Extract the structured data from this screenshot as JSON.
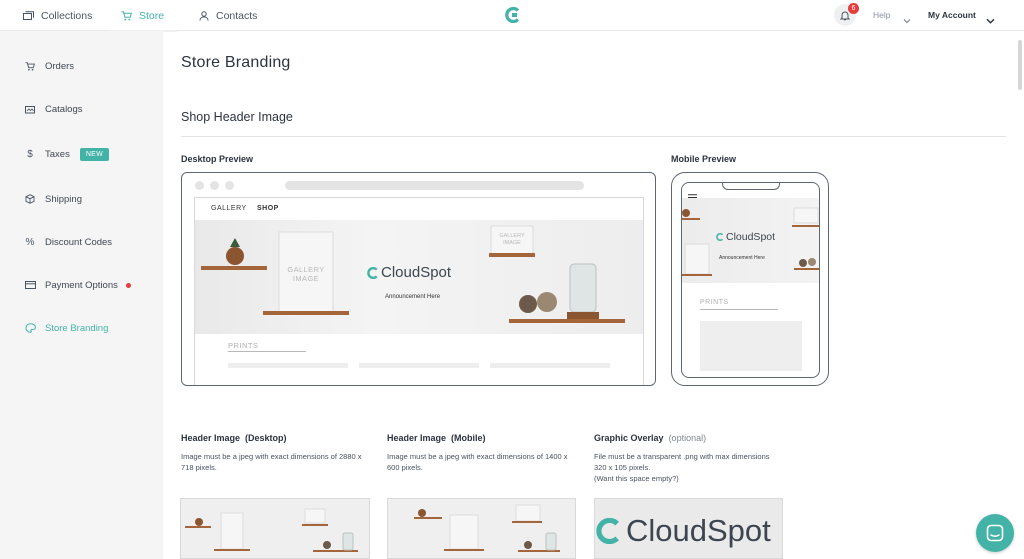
{
  "topnav": {
    "items": [
      {
        "label": "Collections",
        "icon": "collections-icon"
      },
      {
        "label": "Store",
        "icon": "cart-icon",
        "active": true
      },
      {
        "label": "Contacts",
        "icon": "contacts-icon"
      }
    ],
    "notification_count": "6",
    "help_label": "Help",
    "account_label": "My Account"
  },
  "sidebar": {
    "items": [
      {
        "label": "Orders",
        "icon": "cart-icon"
      },
      {
        "label": "Catalogs",
        "icon": "catalog-icon"
      },
      {
        "label": "Taxes",
        "icon": "dollar-icon",
        "badge": "NEW"
      },
      {
        "label": "Shipping",
        "icon": "box-icon"
      },
      {
        "label": "Discount Codes",
        "icon": "percent-icon"
      },
      {
        "label": "Payment Options",
        "icon": "card-icon",
        "alert_dot": true
      },
      {
        "label": "Store Branding",
        "icon": "palette-icon",
        "active": true
      }
    ]
  },
  "main": {
    "page_title": "Store Branding",
    "section_title": "Shop Header Image",
    "desktop_preview_label": "Desktop Preview",
    "mobile_preview_label": "Mobile Preview",
    "preview": {
      "nav_gallery": "GALLERY",
      "nav_shop": "SHOP",
      "brand_name": "CloudSpot",
      "announcement": "Announcement Here",
      "gallery_image_text": "GALLERY IMAGE",
      "prints_label": "PRINTS"
    },
    "uploads": [
      {
        "title": "Header Image",
        "sub": "(Desktop)",
        "desc": "Image must be a jpeg with exact dimensions of 2880 x 718 pixels."
      },
      {
        "title": "Header Image",
        "sub": "(Mobile)",
        "desc": "Image must be a jpeg with exact dimensions of 1400 x 600 pixels."
      },
      {
        "title": "Graphic Overlay",
        "sub": "(optional)",
        "desc": "File must be a transparent .png with max dimensions 320 x 105 pixels.",
        "desc2": "(Want this space empty?)"
      }
    ],
    "overlay_thumb_text": "CloudSpot"
  },
  "colors": {
    "accent": "#44b3a7",
    "alert": "#e53c3c",
    "sidebar_bg": "#f5f5f6",
    "text_dark": "#2c3440"
  }
}
